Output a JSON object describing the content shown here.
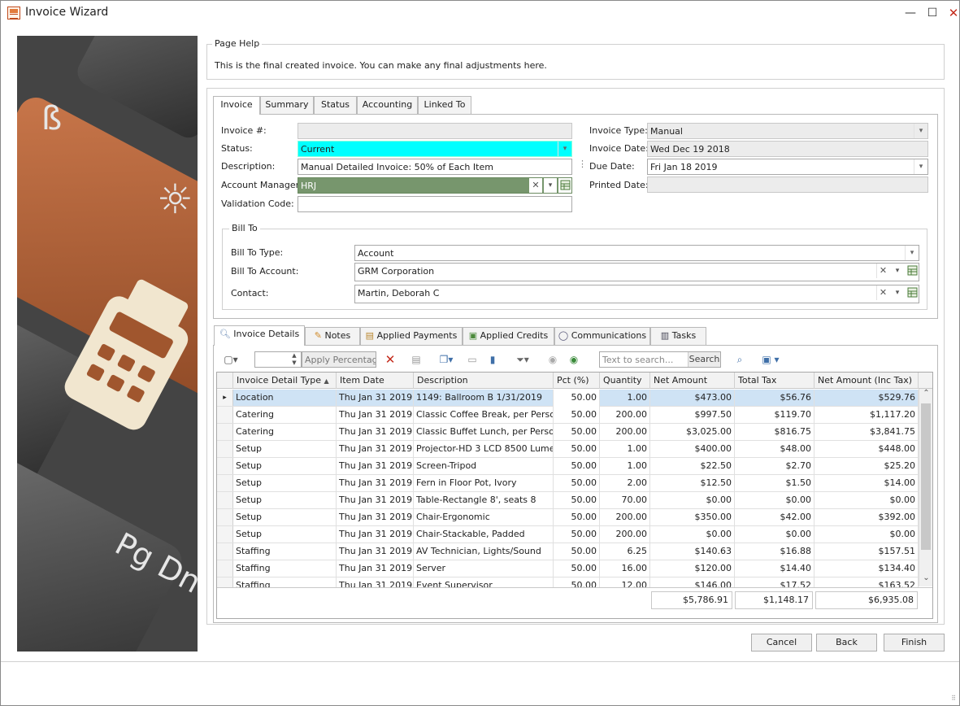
{
  "window": {
    "title": "Invoice Wizard",
    "min": "—",
    "max": "☐",
    "close": "✕"
  },
  "page_help": {
    "title": "Page Help",
    "text": "This is the final created invoice.  You can make any final adjustments here."
  },
  "top_tabs": [
    "Invoice",
    "Summary",
    "Status",
    "Accounting",
    "Linked To"
  ],
  "invoice": {
    "invoice_no_label": "Invoice #:",
    "invoice_no": "",
    "status_label": "Status:",
    "status": "Current",
    "description_label": "Description:",
    "description": "Manual Detailed Invoice: 50% of Each Item",
    "account_manager_label": "Account Manager:",
    "account_manager": "HRJ",
    "validation_label": "Validation Code:",
    "validation": "",
    "invoice_type_label": "Invoice Type:",
    "invoice_type": "Manual",
    "invoice_date_label": "Invoice Date:",
    "invoice_date": "Wed Dec 19 2018",
    "due_date_label": "Due Date:",
    "due_date": "Fri Jan 18 2019",
    "printed_date_label": "Printed Date:",
    "printed_date": ""
  },
  "bill_to": {
    "title": "Bill To",
    "type_label": "Bill To Type:",
    "type": "Account",
    "account_label": "Bill To Account:",
    "account": "GRM Corporation",
    "contact_label": "Contact:",
    "contact": "Martin, Deborah C"
  },
  "detail_tabs": [
    "Invoice Details",
    "Notes",
    "Applied Payments",
    "Applied Credits",
    "Communications",
    "Tasks"
  ],
  "toolbar": {
    "apply_label": "Apply Percentage",
    "search_placeholder": "Text to search...",
    "search_button": "Search"
  },
  "grid": {
    "columns": [
      "Invoice Detail Type",
      "Item Date",
      "Description",
      "Pct (%)",
      "Quantity",
      "Net Amount",
      "Total Tax",
      "Net Amount (Inc Tax)"
    ],
    "rows": [
      [
        "Location",
        "Thu Jan 31 2019",
        "1149: Ballroom B 1/31/2019",
        "50.00",
        "1.00",
        "$473.00",
        "$56.76",
        "$529.76"
      ],
      [
        "Catering",
        "Thu Jan 31 2019",
        "Classic Coffee Break, per Person",
        "50.00",
        "200.00",
        "$997.50",
        "$119.70",
        "$1,117.20"
      ],
      [
        "Catering",
        "Thu Jan 31 2019",
        "Classic Buffet Lunch, per Person",
        "50.00",
        "200.00",
        "$3,025.00",
        "$816.75",
        "$3,841.75"
      ],
      [
        "Setup",
        "Thu Jan 31 2019",
        "Projector-HD 3 LCD 8500 Lumens",
        "50.00",
        "1.00",
        "$400.00",
        "$48.00",
        "$448.00"
      ],
      [
        "Setup",
        "Thu Jan 31 2019",
        "Screen-Tripod",
        "50.00",
        "1.00",
        "$22.50",
        "$2.70",
        "$25.20"
      ],
      [
        "Setup",
        "Thu Jan 31 2019",
        "Fern in Floor Pot, Ivory",
        "50.00",
        "2.00",
        "$12.50",
        "$1.50",
        "$14.00"
      ],
      [
        "Setup",
        "Thu Jan 31 2019",
        "Table-Rectangle 8', seats 8",
        "50.00",
        "70.00",
        "$0.00",
        "$0.00",
        "$0.00"
      ],
      [
        "Setup",
        "Thu Jan 31 2019",
        "Chair-Ergonomic",
        "50.00",
        "200.00",
        "$350.00",
        "$42.00",
        "$392.00"
      ],
      [
        "Setup",
        "Thu Jan 31 2019",
        "Chair-Stackable, Padded",
        "50.00",
        "200.00",
        "$0.00",
        "$0.00",
        "$0.00"
      ],
      [
        "Staffing",
        "Thu Jan 31 2019",
        "AV Technician, Lights/Sound",
        "50.00",
        "6.25",
        "$140.63",
        "$16.88",
        "$157.51"
      ],
      [
        "Staffing",
        "Thu Jan 31 2019",
        "Server",
        "50.00",
        "16.00",
        "$120.00",
        "$14.40",
        "$134.40"
      ],
      [
        "Staffing",
        "Thu Jan 31 2019",
        "Event Supervisor",
        "50.00",
        "12.00",
        "$146.00",
        "$17.52",
        "$163.52"
      ]
    ],
    "totals": {
      "net": "$5,786.91",
      "tax": "$1,148.17",
      "inc_tax": "$6,935.08"
    }
  },
  "buttons": {
    "cancel": "Cancel",
    "back": "Back",
    "finish": "Finish"
  },
  "colors": {
    "status_bg": "#00ffff",
    "manager_bg": "#77966d",
    "selected_row": "#cfe3f5"
  },
  "side_image": {
    "keys": [
      "ß",
      "☼",
      "Pg Dn E"
    ]
  }
}
